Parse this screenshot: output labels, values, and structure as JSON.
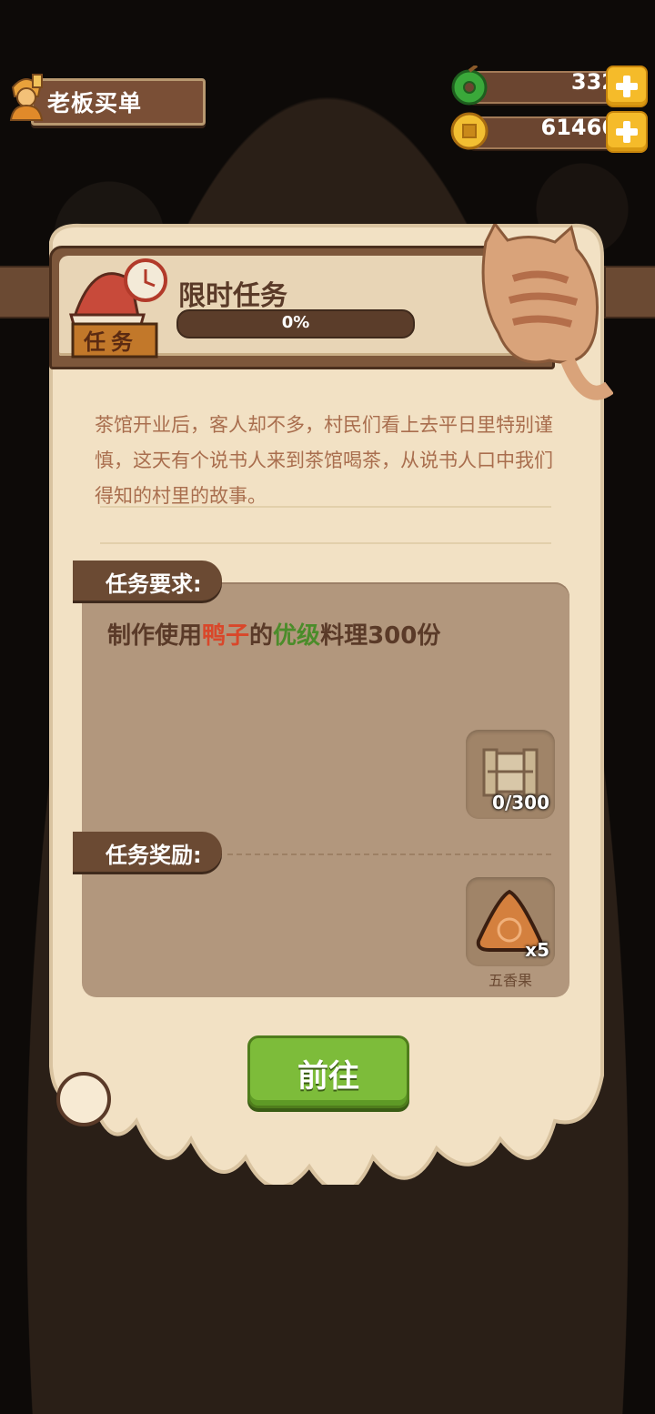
{
  "top_bar": {
    "boss_button_label": "老板买单",
    "jade": {
      "value": "332",
      "icon": "jade-icon"
    },
    "coins": {
      "value": "61466",
      "icon": "coin-icon"
    }
  },
  "task": {
    "badge": "任务",
    "title": "限时任务",
    "progress_label": "0%",
    "progress": 0,
    "description": "茶馆开业后，客人却不多，村民们看上去平日里特别谨慎，这天有个说书人来到茶馆喝茶，从说书人口中我们得知的村里的故事。",
    "requirement_label": "任务要求:",
    "requirement_prefix": "制作使用",
    "requirement_ingredient": "鸭子",
    "requirement_middle": "的",
    "requirement_grade": "优级",
    "requirement_suffix": "料理300份",
    "requirement_count": "0/300",
    "reward_label": "任务奖励:",
    "reward_count": "x5",
    "reward_name": "五香果",
    "go_button": "前往"
  },
  "colors": {
    "ingredient": "#d9472a",
    "grade": "#4b8c2a",
    "button": "#7dbc3a"
  }
}
